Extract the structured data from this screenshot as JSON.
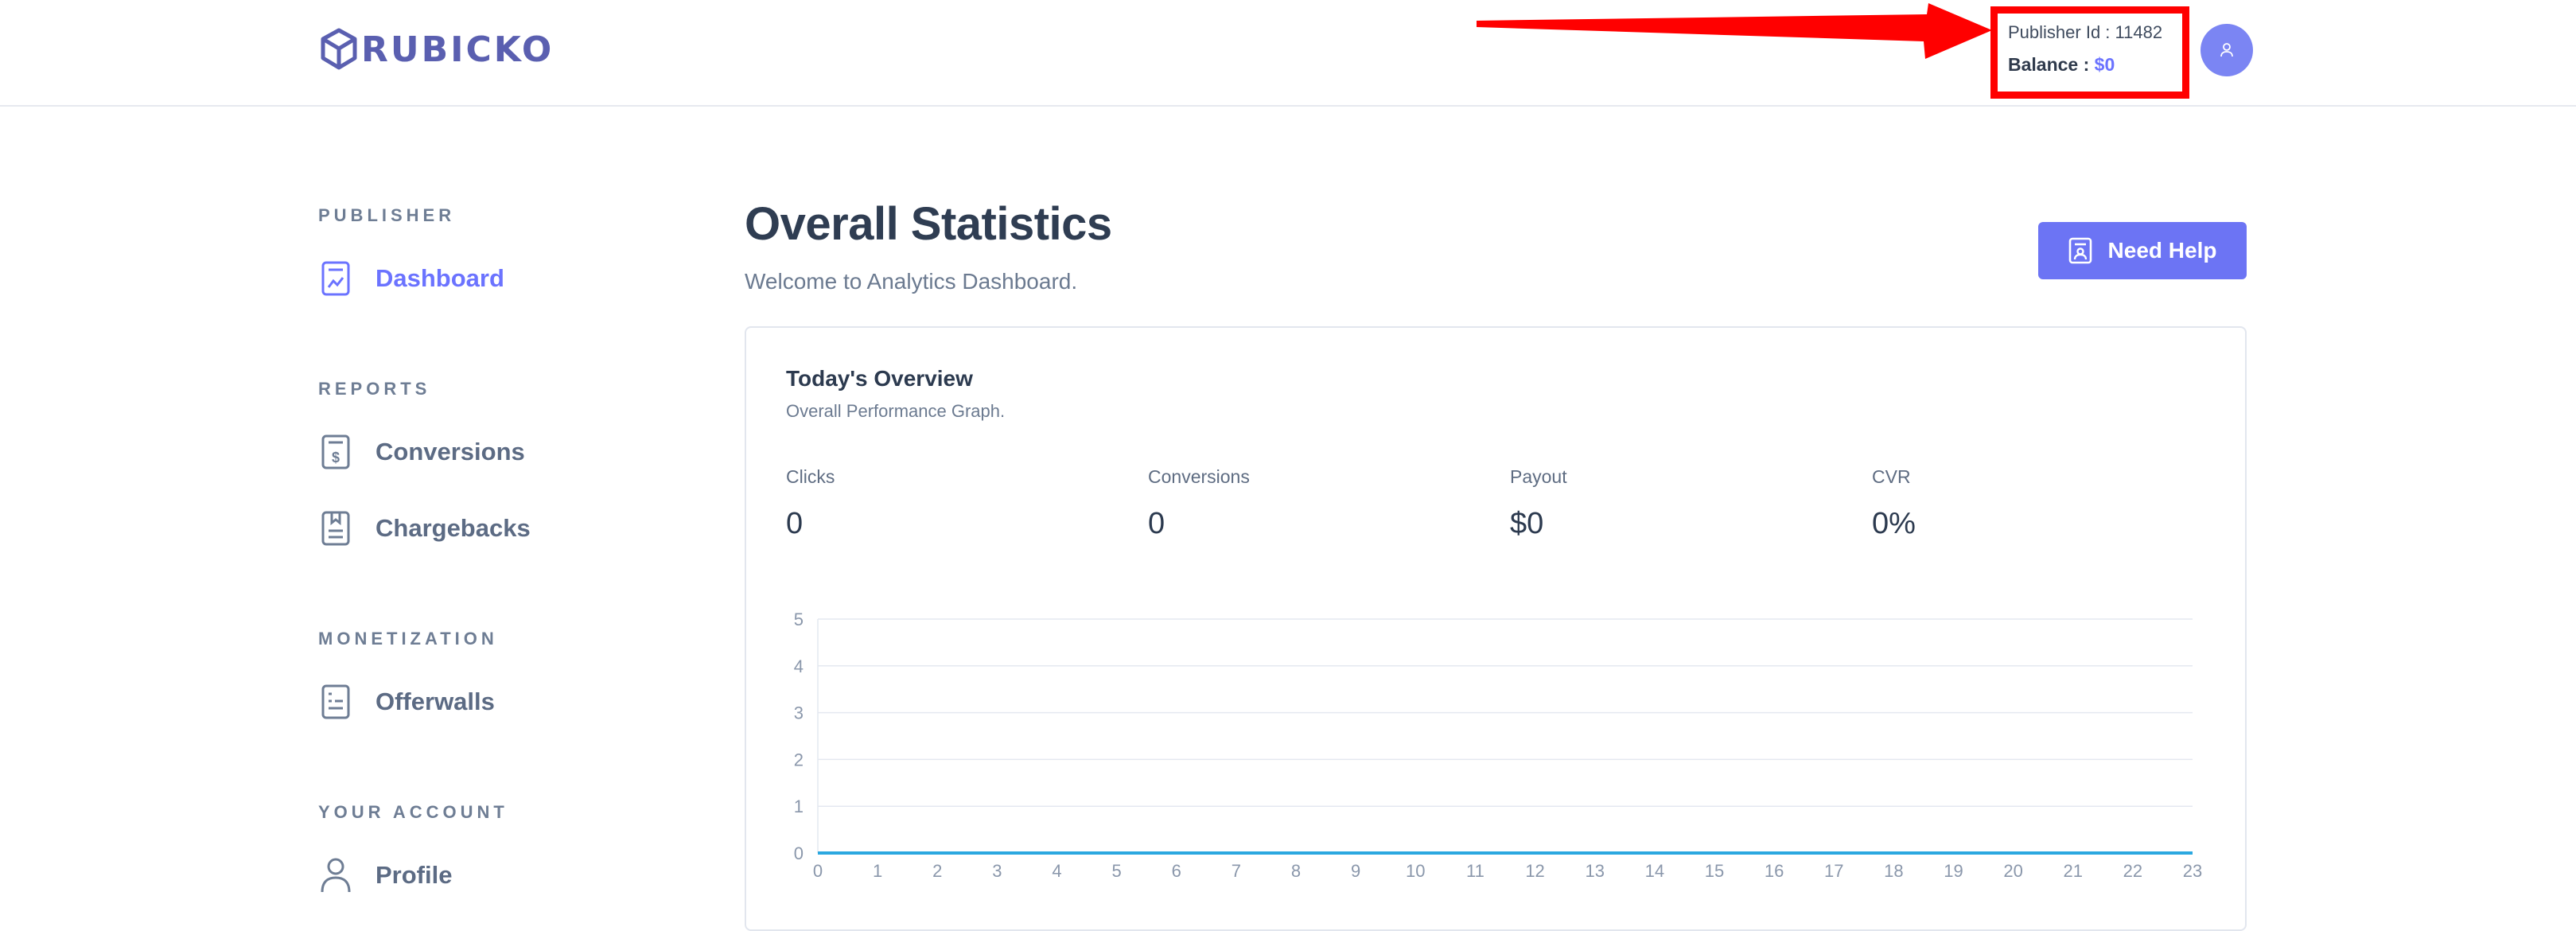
{
  "header": {
    "logo_text": "RUBICKO",
    "publisher_id": "Publisher Id : 11482",
    "balance_label": "Balance :",
    "balance_value": "$0",
    "avatar_icon": "user-icon"
  },
  "sidebar": {
    "sections": [
      {
        "heading": "PUBLISHER",
        "items": [
          {
            "label": "Dashboard",
            "icon": "dashboard-report-icon",
            "active": true
          }
        ]
      },
      {
        "heading": "REPORTS",
        "items": [
          {
            "label": "Conversions",
            "icon": "dollar-document-icon"
          },
          {
            "label": "Chargebacks",
            "icon": "bookmark-document-icon"
          }
        ]
      },
      {
        "heading": "MONETIZATION",
        "items": [
          {
            "label": "Offerwalls",
            "icon": "list-document-icon"
          }
        ]
      },
      {
        "heading": "YOUR ACCOUNT",
        "items": [
          {
            "label": "Profile",
            "icon": "person-icon"
          }
        ]
      }
    ]
  },
  "main": {
    "title": "Overall Statistics",
    "subtitle": "Welcome to Analytics Dashboard.",
    "help_button": "Need Help",
    "card": {
      "title": "Today's Overview",
      "subtitle": "Overall Performance Graph.",
      "stats": [
        {
          "label": "Clicks",
          "value": "0"
        },
        {
          "label": "Conversions",
          "value": "0"
        },
        {
          "label": "Payout",
          "value": "$0"
        },
        {
          "label": "CVR",
          "value": "0%"
        }
      ]
    }
  },
  "colors": {
    "accent": "#6c74f4",
    "line": "#2ba8e0",
    "highlight": "#ff0000"
  },
  "chart_data": {
    "type": "line",
    "x": [
      0,
      1,
      2,
      3,
      4,
      5,
      6,
      7,
      8,
      9,
      10,
      11,
      12,
      13,
      14,
      15,
      16,
      17,
      18,
      19,
      20,
      21,
      22,
      23
    ],
    "series": [
      {
        "values": [
          0,
          0,
          0,
          0,
          0,
          0,
          0,
          0,
          0,
          0,
          0,
          0,
          0,
          0,
          0,
          0,
          0,
          0,
          0,
          0,
          0,
          0,
          0,
          0
        ]
      }
    ],
    "yticks": [
      0,
      1,
      2,
      3,
      4,
      5
    ],
    "ylim": [
      0,
      5
    ],
    "xlim": [
      0,
      23
    ],
    "grid": true
  }
}
